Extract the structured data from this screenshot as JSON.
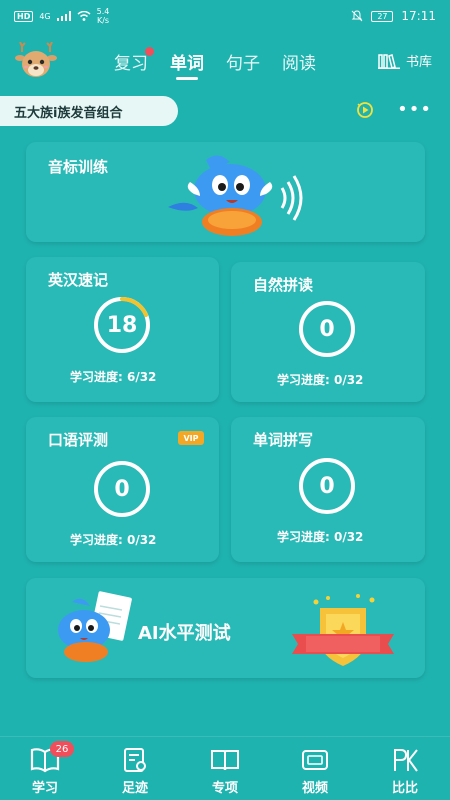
{
  "status_bar": {
    "hd": "HD",
    "network": "4G",
    "speed_value": "5.4",
    "speed_unit": "K/s",
    "battery": "27",
    "time": "17:11"
  },
  "header": {
    "tabs": [
      {
        "label": "复习",
        "has_dot": true
      },
      {
        "label": "单词",
        "active": true
      },
      {
        "label": "句子"
      },
      {
        "label": "阅读"
      }
    ],
    "library_label": "书库"
  },
  "course": {
    "name": "五大族i族发音组合"
  },
  "cards": {
    "phonetic": {
      "title": "音标训练"
    },
    "memory": {
      "title": "英汉速记",
      "count": "18",
      "progress_label": "学习进度: 6/32",
      "progress_fraction": 0.1875
    },
    "phonics": {
      "title": "自然拼读",
      "count": "0",
      "progress_label": "学习进度: 0/32"
    },
    "speaking": {
      "title": "口语评测",
      "vip_label": "VIP",
      "count": "0",
      "progress_label": "学习进度: 0/32"
    },
    "spelling": {
      "title": "单词拼写",
      "count": "0",
      "progress_label": "学习进度: 0/32"
    },
    "ai_test": {
      "title": "AI水平测试"
    }
  },
  "bottom_nav": {
    "items": [
      {
        "label": "学习",
        "badge": "26",
        "icon": "book-icon"
      },
      {
        "label": "足迹",
        "icon": "footprint-icon"
      },
      {
        "label": "专项",
        "icon": "open-book-icon"
      },
      {
        "label": "视频",
        "icon": "tv-icon"
      },
      {
        "label": "比比",
        "icon": "pk-icon"
      }
    ]
  },
  "colors": {
    "background": "#1fb3b0",
    "card": "#29bab7",
    "badge": "#f04e5a",
    "progress_arc": "#f3c22c",
    "vip": "#f3a724"
  }
}
